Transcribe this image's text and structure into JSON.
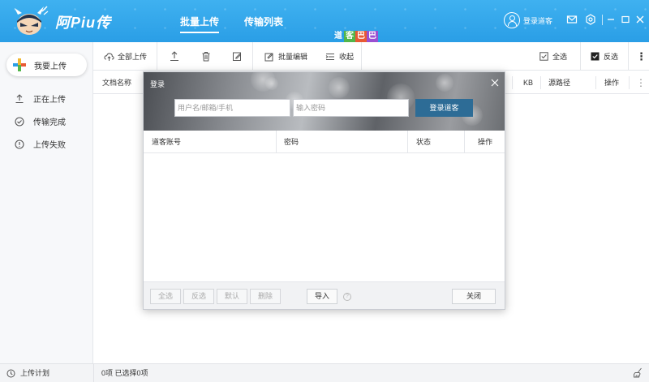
{
  "app": {
    "name": "阿Piu传",
    "nav_tabs": [
      {
        "label": "批量上传",
        "active": true
      },
      {
        "label": "传输列表",
        "active": false
      }
    ],
    "login_label": "登录道客",
    "promo_chars": [
      "道",
      "客",
      "巴",
      "巴"
    ],
    "promo_colors": [
      "#2a9ee6",
      "#52b64a",
      "#e85a34",
      "#9b4fd1"
    ]
  },
  "sidebar": {
    "upload_button": "我要上传",
    "items": [
      {
        "label": "正在上传",
        "icon": "upload-arrow-icon"
      },
      {
        "label": "传输完成",
        "icon": "check-circle-icon"
      },
      {
        "label": "上传失败",
        "icon": "alert-circle-icon"
      }
    ]
  },
  "toolbar": {
    "upload_all": "全部上传",
    "batch_edit": "批量编辑",
    "collapse": "收起",
    "select_all": "全选",
    "invert": "反选"
  },
  "table": {
    "columns": [
      "文档名称",
      "KB",
      "源路径",
      "操作"
    ]
  },
  "statusbar": {
    "plan": "上传计划",
    "count": "0项 已选择0项"
  },
  "dialog": {
    "title": "登录",
    "username_placeholder": "用户名/邮箱/手机",
    "password_placeholder": "输入密码",
    "login_button": "登录道客",
    "columns": [
      "道客账号",
      "密码",
      "状态",
      "操作"
    ],
    "footer_buttons": [
      "全选",
      "反选",
      "默认",
      "删除"
    ],
    "import_button": "导入",
    "close_button": "关闭"
  },
  "colors": {
    "titlebar": "#2a9ee6",
    "login_button": "#2d6c96"
  }
}
